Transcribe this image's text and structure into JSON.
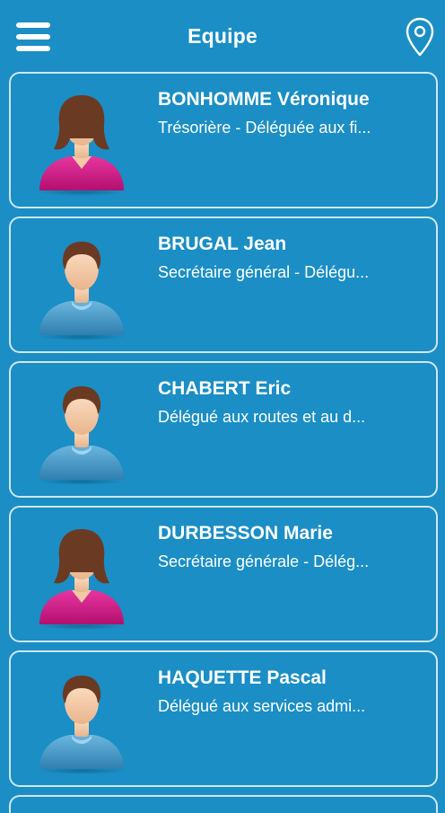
{
  "header": {
    "title": "Equipe",
    "menu_icon": "hamburger-menu-icon",
    "location_icon": "map-pin-icon"
  },
  "colors": {
    "background": "#1a8ec5",
    "card_border": "#cfe7f4",
    "female_shirt": "#d81b8c",
    "male_shirt": "#4aa2d2",
    "text": "#ffffff"
  },
  "members": [
    {
      "name": "BONHOMME Véronique",
      "role": "Trésorière - Déléguée aux fi...",
      "avatar": "female"
    },
    {
      "name": "BRUGAL Jean",
      "role": "Secrétaire général - Délégu...",
      "avatar": "male"
    },
    {
      "name": "CHABERT Eric",
      "role": "Délégué aux routes et au d...",
      "avatar": "male"
    },
    {
      "name": "DURBESSON Marie",
      "role": "Secrétaire générale - Délég...",
      "avatar": "female"
    },
    {
      "name": "HAQUETTE Pascal",
      "role": "Délégué aux services admi...",
      "avatar": "male"
    }
  ]
}
